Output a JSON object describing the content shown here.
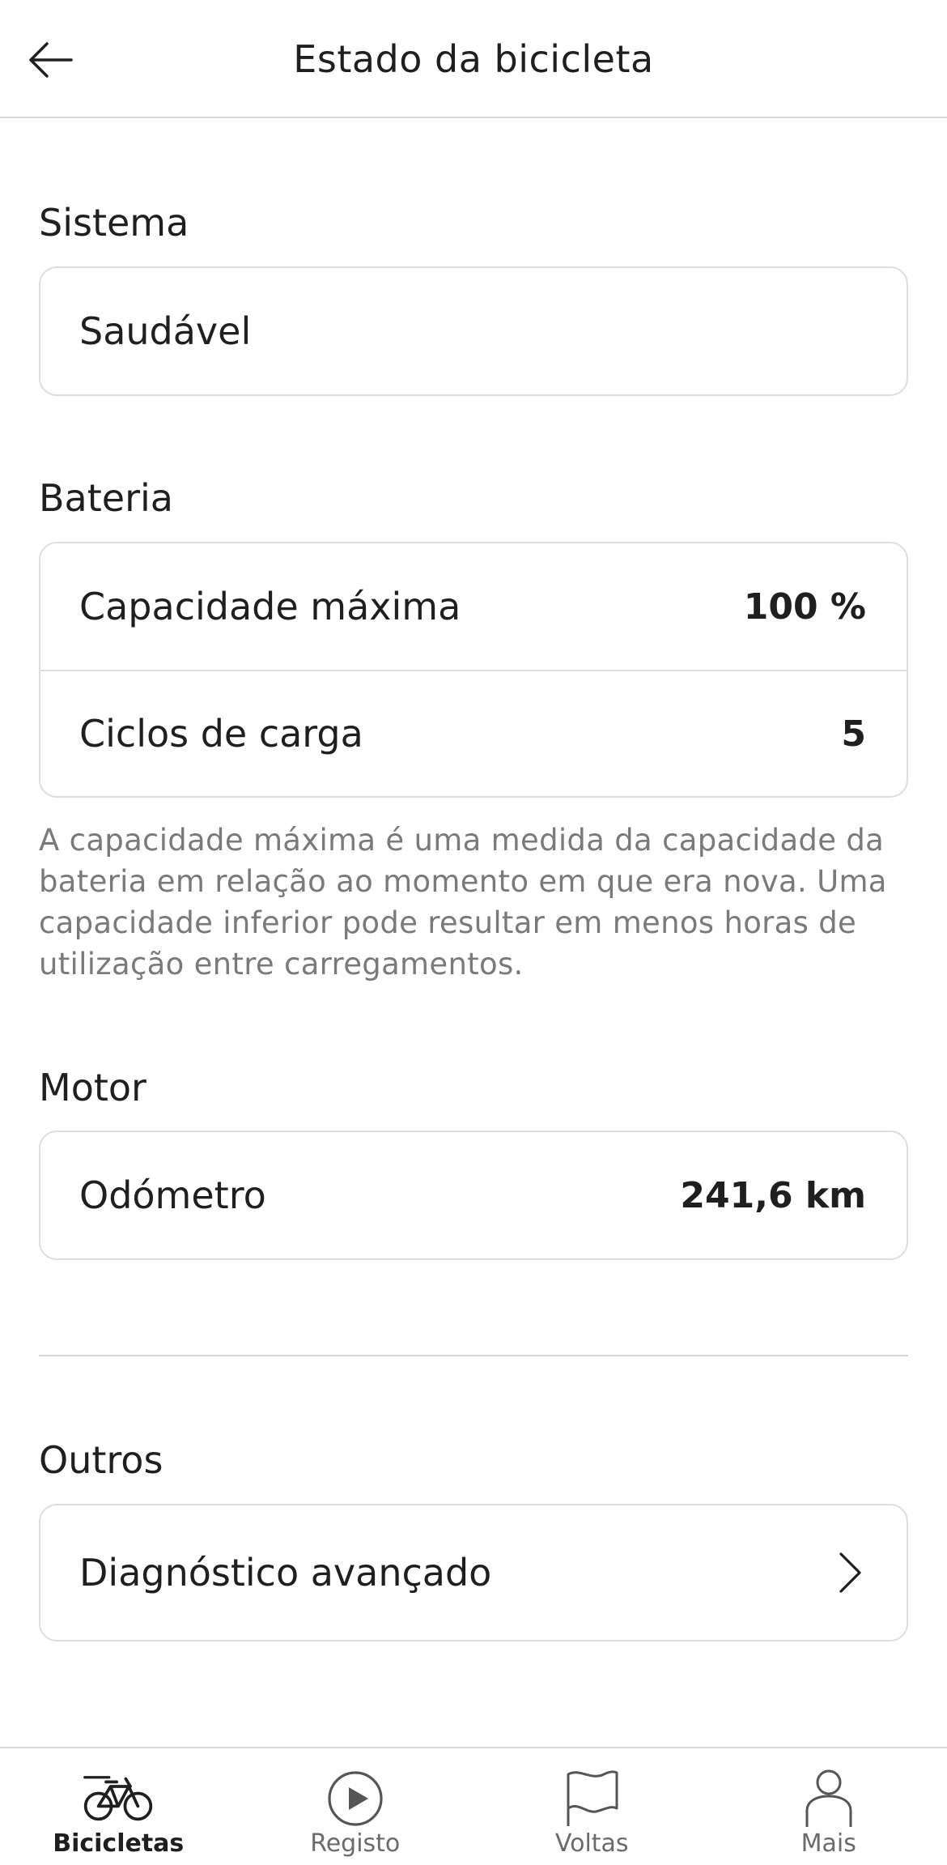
{
  "header": {
    "title": "Estado da bicicleta",
    "back_icon": "arrow-left-icon"
  },
  "sistema": {
    "title": "Sistema",
    "status": "Saudável"
  },
  "bateria": {
    "title": "Bateria",
    "rows": [
      {
        "label": "Capacidade máxima",
        "value": "100 %"
      },
      {
        "label": "Ciclos de carga",
        "value": "5"
      }
    ],
    "note": "A capacidade máxima é uma medida da capacidade da bateria em relação ao momento em que era nova. Uma capacidade inferior pode resultar em menos horas de utilização entre carregamentos."
  },
  "motor": {
    "title": "Motor",
    "rows": [
      {
        "label": "Odómetro",
        "value": "241,6 km"
      }
    ]
  },
  "outros": {
    "title": "Outros",
    "rows": [
      {
        "label": "Diagnóstico avançado",
        "icon": "chevron-right-icon"
      }
    ]
  },
  "tabbar": {
    "tabs": [
      {
        "label": "Bicicletas",
        "icon": "bicycle-icon",
        "active": true
      },
      {
        "label": "Registo",
        "icon": "play-circle-icon",
        "active": false
      },
      {
        "label": "Voltas",
        "icon": "flag-icon",
        "active": false
      },
      {
        "label": "Mais",
        "icon": "person-icon",
        "active": false
      }
    ]
  },
  "colors": {
    "text": "#1f1f1f",
    "muted": "#7a7a7a",
    "border": "#dedede",
    "background": "#ffffff"
  }
}
